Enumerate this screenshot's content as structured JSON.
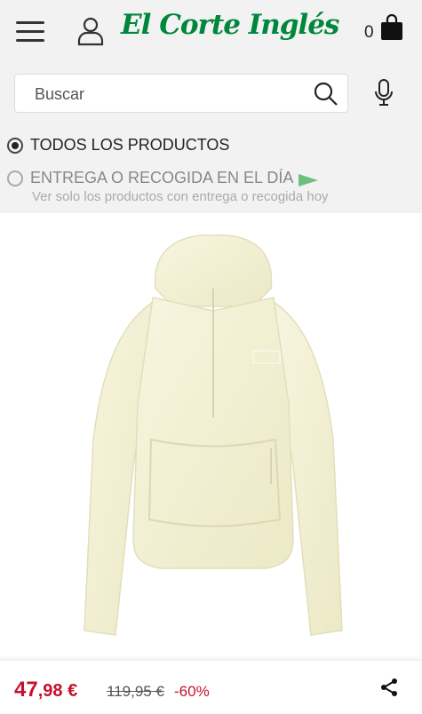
{
  "header": {
    "logo_text": "El Corte Inglés",
    "cart_count": "0"
  },
  "search": {
    "placeholder": "Buscar"
  },
  "filters": {
    "option_all": "TODOS LOS PRODUCTOS",
    "option_today": "ENTREGA O RECOGIDA EN EL DÍA",
    "option_today_sub": "Ver solo los productos con entrega o recogida hoy"
  },
  "product": {
    "image_alt": "Chaqueta cortavientos The North Face color crema"
  },
  "price": {
    "current_int": "47",
    "current_dec": ",98 €",
    "original": "119,95 €",
    "discount": "-60%"
  },
  "colors": {
    "brand_green": "#00873c",
    "price_red": "#c8102e"
  }
}
